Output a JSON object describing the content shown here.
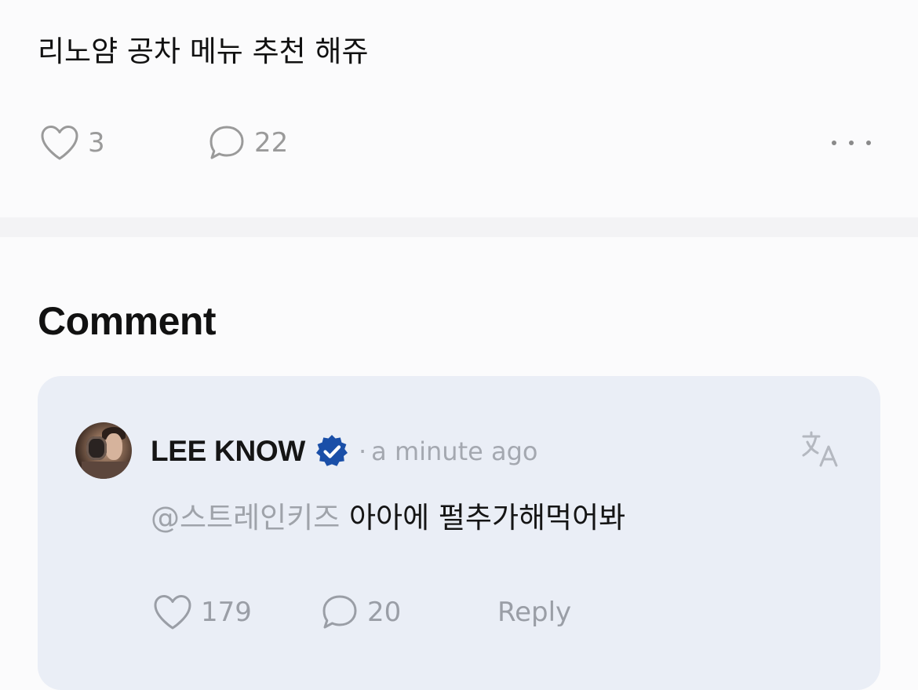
{
  "post": {
    "text": "리노얌 공차 메뉴 추천 해쥬",
    "like_count": "3",
    "comment_count": "22",
    "icons": {
      "like": "heart-outline-icon",
      "comment": "speech-bubble-icon",
      "more": "more-horizontal-icon"
    }
  },
  "comments_section": {
    "heading": "Comment"
  },
  "comment": {
    "author": "LEE KNOW",
    "verified": true,
    "separator": "·",
    "timestamp": "a minute ago",
    "mention": "@스트레인키즈",
    "body": "아아에 펄추가해먹어봐",
    "like_count": "179",
    "reply_count": "20",
    "reply_label": "Reply",
    "icons": {
      "avatar": "avatar",
      "verified": "verified-badge-icon",
      "translate": "translate-icon",
      "like": "heart-outline-icon",
      "comment": "speech-bubble-icon"
    }
  },
  "colors": {
    "background": "#fbfbfc",
    "divider": "#f3f3f5",
    "comment_card": "#eaeef6",
    "verified_badge": "#1a4fa8",
    "muted_text": "#9a9ea6",
    "primary_text": "#111111"
  }
}
